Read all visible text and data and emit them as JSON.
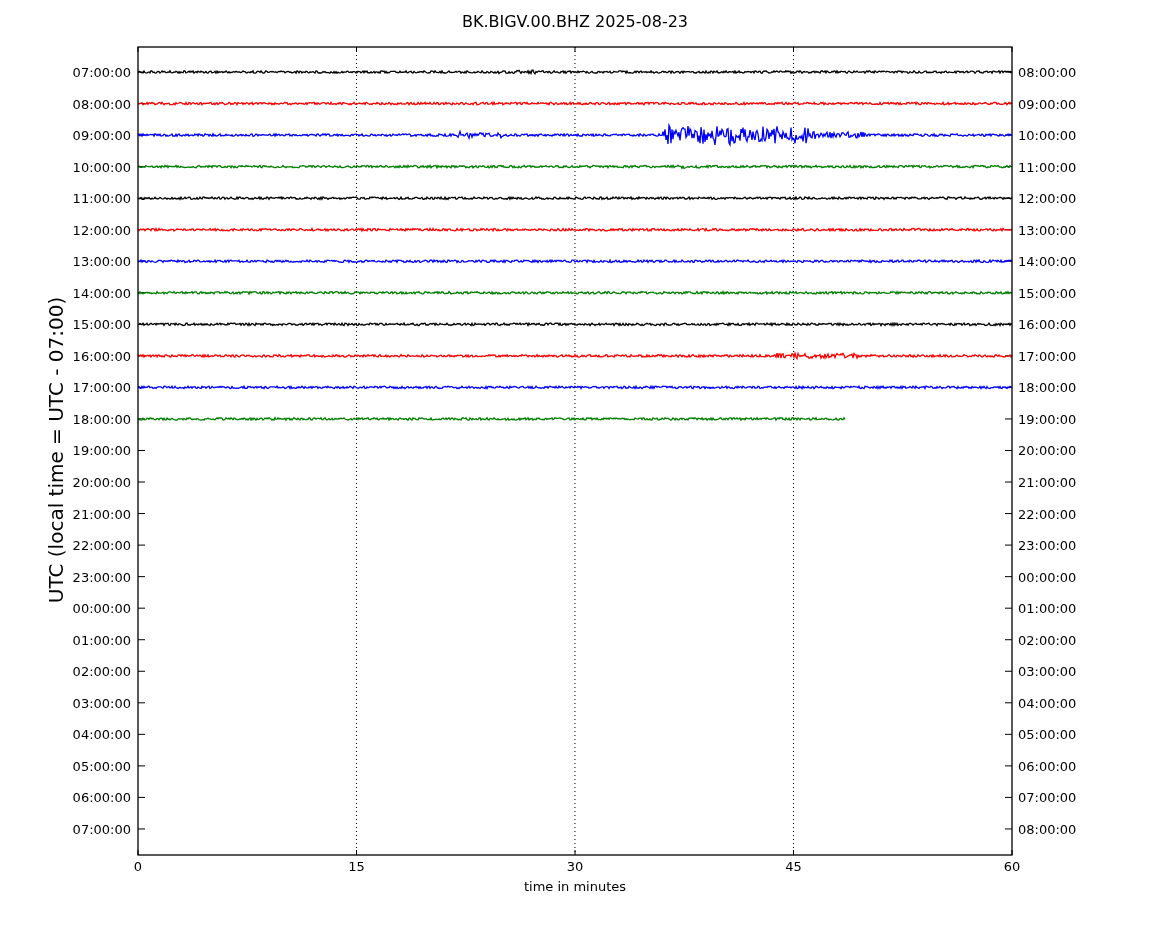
{
  "title": "BK.BIGV.00.BHZ 2025-08-23",
  "ylabel": "UTC (local time = UTC - 07:00)",
  "xlabel": "time in minutes",
  "xticks": [
    "0",
    "15",
    "30",
    "45",
    "60"
  ],
  "rows": [
    {
      "left": "07:00:00",
      "right": "08:00:00"
    },
    {
      "left": "08:00:00",
      "right": "09:00:00"
    },
    {
      "left": "09:00:00",
      "right": "10:00:00"
    },
    {
      "left": "10:00:00",
      "right": "11:00:00"
    },
    {
      "left": "11:00:00",
      "right": "12:00:00"
    },
    {
      "left": "12:00:00",
      "right": "13:00:00"
    },
    {
      "left": "13:00:00",
      "right": "14:00:00"
    },
    {
      "left": "14:00:00",
      "right": "15:00:00"
    },
    {
      "left": "15:00:00",
      "right": "16:00:00"
    },
    {
      "left": "16:00:00",
      "right": "17:00:00"
    },
    {
      "left": "17:00:00",
      "right": "18:00:00"
    },
    {
      "left": "18:00:00",
      "right": "19:00:00"
    },
    {
      "left": "19:00:00",
      "right": "20:00:00"
    },
    {
      "left": "20:00:00",
      "right": "21:00:00"
    },
    {
      "left": "21:00:00",
      "right": "22:00:00"
    },
    {
      "left": "22:00:00",
      "right": "23:00:00"
    },
    {
      "left": "23:00:00",
      "right": "00:00:00"
    },
    {
      "left": "00:00:00",
      "right": "01:00:00"
    },
    {
      "left": "01:00:00",
      "right": "02:00:00"
    },
    {
      "left": "02:00:00",
      "right": "03:00:00"
    },
    {
      "left": "03:00:00",
      "right": "04:00:00"
    },
    {
      "left": "04:00:00",
      "right": "05:00:00"
    },
    {
      "left": "05:00:00",
      "right": "06:00:00"
    },
    {
      "left": "06:00:00",
      "right": "07:00:00"
    },
    {
      "left": "07:00:00",
      "right": "08:00:00"
    }
  ],
  "traces": [
    {
      "color": "#000000",
      "level": 1
    },
    {
      "color": "#ff0000",
      "level": 1
    },
    {
      "color": "#0000ff",
      "level": 1
    },
    {
      "color": "#008000",
      "level": 1
    },
    {
      "color": "#000000",
      "level": 1
    },
    {
      "color": "#ff0000",
      "level": 1
    },
    {
      "color": "#0000ff",
      "level": 1
    },
    {
      "color": "#008000",
      "level": 1
    },
    {
      "color": "#000000",
      "level": 1
    },
    {
      "color": "#ff0000",
      "level": 1
    },
    {
      "color": "#0000ff",
      "level": 1
    },
    {
      "color": "#008000",
      "level": 0.81
    }
  ]
}
